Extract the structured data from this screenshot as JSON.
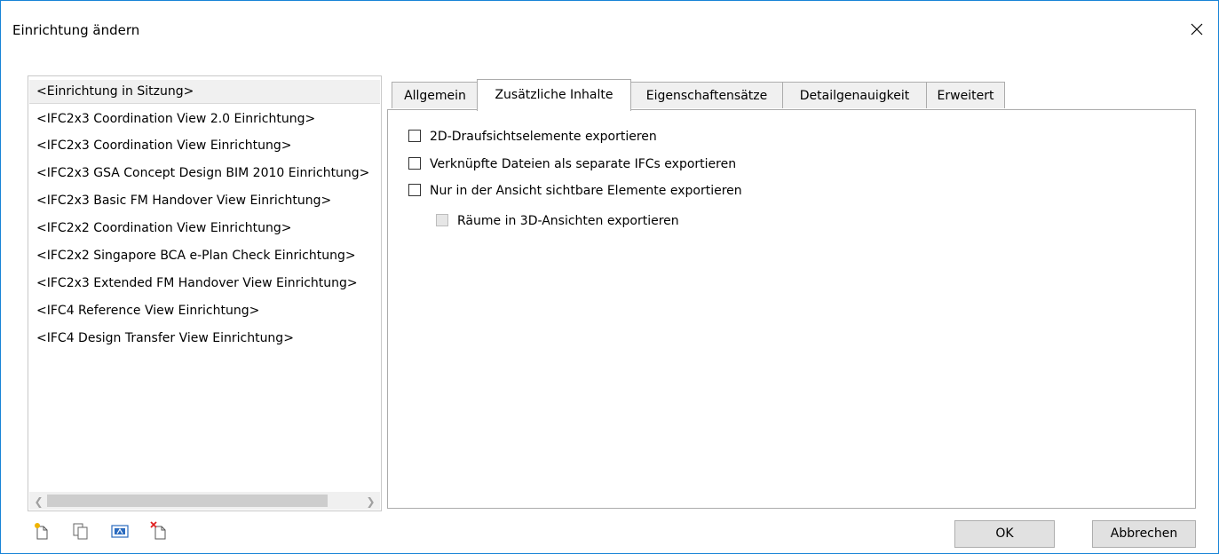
{
  "window": {
    "title": "Einrichtung ändern"
  },
  "setups": [
    "<Einrichtung in Sitzung>",
    "<IFC2x3 Coordination View 2.0 Einrichtung>",
    "<IFC2x3 Coordination View Einrichtung>",
    "<IFC2x3 GSA Concept Design BIM 2010 Einrichtung>",
    "<IFC2x3 Basic FM Handover View Einrichtung>",
    "<IFC2x2 Coordination View Einrichtung>",
    "<IFC2x2 Singapore BCA e-Plan Check Einrichtung>",
    "<IFC2x3 Extended FM Handover View Einrichtung>",
    "<IFC4 Reference View Einrichtung>",
    "<IFC4 Design Transfer View Einrichtung>"
  ],
  "selected_setup_index": 0,
  "tabs": [
    {
      "label": "Allgemein",
      "active": false
    },
    {
      "label": "Zusätzliche Inhalte",
      "active": true
    },
    {
      "label": "Eigenschaftensätze",
      "active": false
    },
    {
      "label": "Detailgenauigkeit",
      "active": false
    },
    {
      "label": "Erweitert",
      "active": false
    }
  ],
  "options": [
    {
      "label": "2D-Draufsichtselemente exportieren",
      "checked": false,
      "enabled": true
    },
    {
      "label": "Verknüpfte Dateien als separate IFCs exportieren",
      "checked": false,
      "enabled": true
    },
    {
      "label": "Nur in der Ansicht sichtbare Elemente exportieren",
      "checked": false,
      "enabled": true
    },
    {
      "label": "Räume in 3D-Ansichten exportieren",
      "checked": false,
      "enabled": false
    }
  ],
  "toolbar_icons": [
    "new-setup-icon",
    "duplicate-setup-icon",
    "rename-setup-icon",
    "delete-setup-icon"
  ],
  "buttons": {
    "ok": "OK",
    "cancel": "Abbrechen"
  },
  "colors": {
    "window_border": "#1883d7",
    "selection_bg": "#f0f0f0",
    "button_bg": "#e1e1e1"
  }
}
